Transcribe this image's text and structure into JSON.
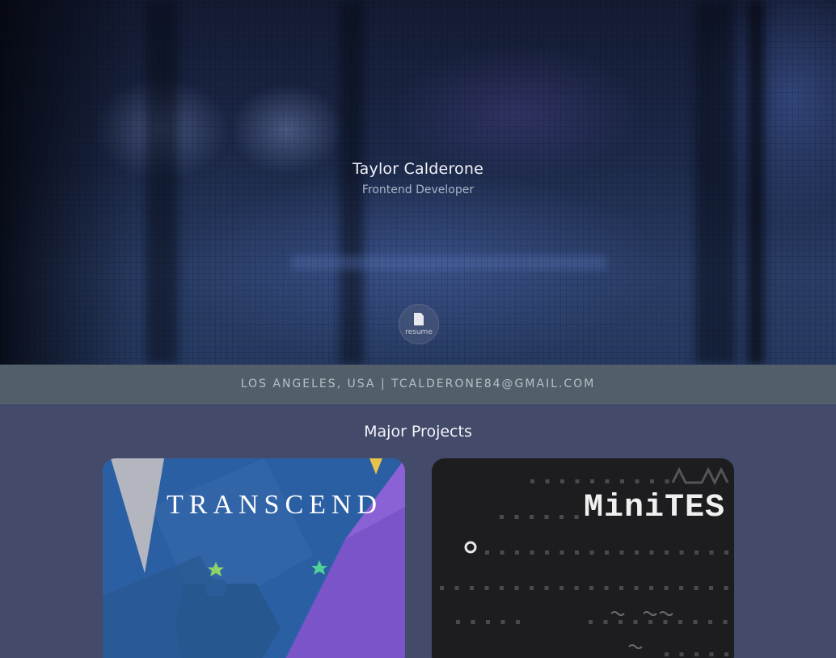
{
  "hero": {
    "name": "Taylor Calderone",
    "role": "Frontend Developer",
    "resume_label": "resume"
  },
  "contact": {
    "text": "LOS ANGELES, USA | TCALDERONE84@GMAIL.COM"
  },
  "projects": {
    "title": "Major Projects",
    "items": [
      {
        "title": "TRANSCEND",
        "accent": "#7a55c9"
      },
      {
        "title": "MiniTES",
        "accent": "#1d1d1f"
      }
    ]
  },
  "colors": {
    "page_bg": "#434a6a",
    "contact_bar": "#525f6a",
    "hero_text": "#f2f4fa"
  }
}
